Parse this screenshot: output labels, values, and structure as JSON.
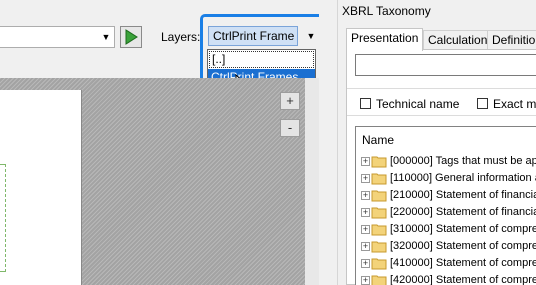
{
  "toolbar": {
    "layers_label": "Layers:",
    "layers_selected": "CtrlPrint Frame",
    "dropdown_options": [
      "[..]",
      "CtrlPrint Frames"
    ],
    "highlight_color": "#1a7fe6"
  },
  "canvas": {
    "zoom_in": "+",
    "zoom_out": "-"
  },
  "panel": {
    "title": "XBRL Taxonomy",
    "tabs": [
      "Presentation",
      "Calculation",
      "Definition"
    ],
    "active_tab": "Presentation",
    "search_value": "",
    "option_technical_name": "Technical name",
    "option_exact_match": "Exact matc",
    "tree_header": "Name",
    "rows": [
      "[000000] Tags that must be ap",
      "[110000] General information a",
      "[210000] Statement of financia",
      "[220000] Statement of financia",
      "[310000] Statement of compre",
      "[320000] Statement of compre",
      "[410000] Statement of compre",
      "[420000] Statement of compre"
    ]
  },
  "icons": {
    "play": "play-icon",
    "folder": "folder-icon",
    "expand": "expand-plus-icon",
    "cursor": "mouse-pointer-icon"
  }
}
